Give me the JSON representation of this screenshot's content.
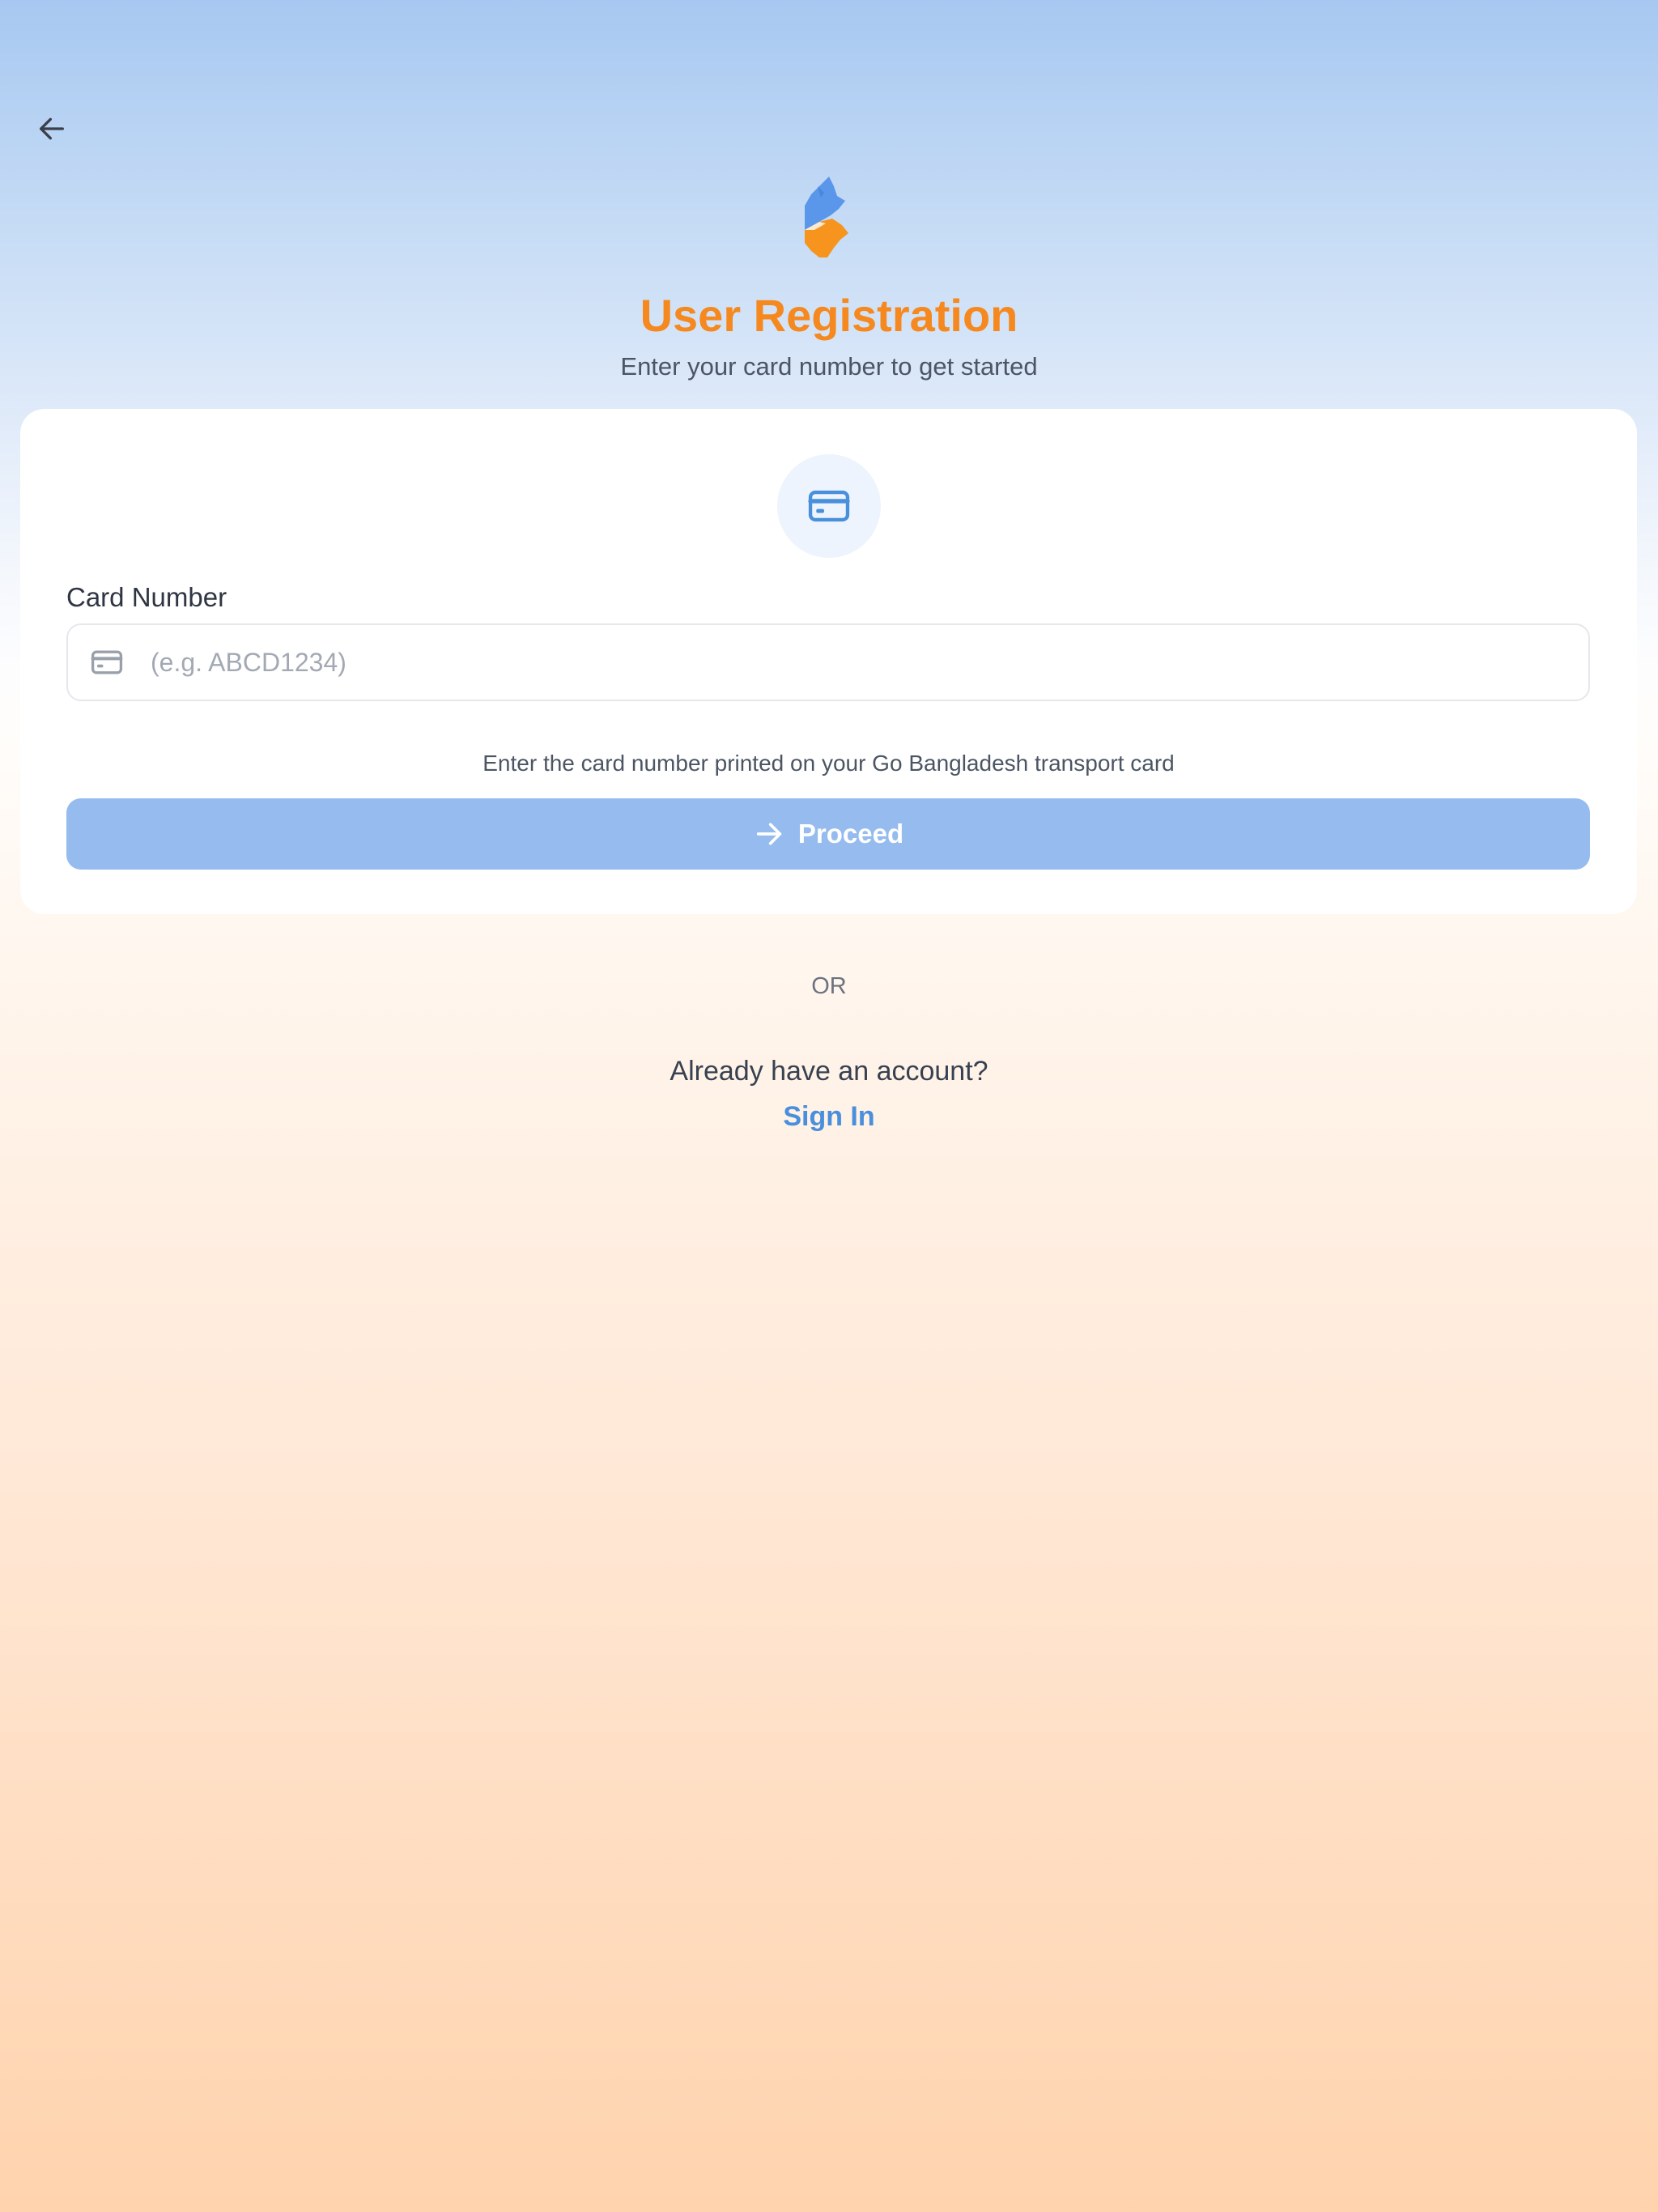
{
  "header": {
    "back_icon": "arrow-left-icon",
    "logo_icon": "go-bangladesh-logo",
    "title": "User Registration",
    "subtitle": "Enter your card number to get started"
  },
  "form": {
    "card_icon": "credit-card-icon",
    "field_label": "Card Number",
    "input_icon": "credit-card-icon",
    "input_value": "",
    "input_placeholder": "(e.g. ABCD1234)",
    "helper_text": "Enter the card number printed on your Go Bangladesh transport card",
    "proceed_icon": "arrow-right-icon",
    "proceed_label": "Proceed"
  },
  "footer": {
    "divider_text": "OR",
    "account_prompt": "Already have an account?",
    "signin_label": "Sign In"
  },
  "colors": {
    "accent_orange": "#f5891f",
    "accent_blue": "#4a8fdc",
    "button_disabled_blue": "#95bbef",
    "icon_circle_bg": "#edf4fd"
  }
}
